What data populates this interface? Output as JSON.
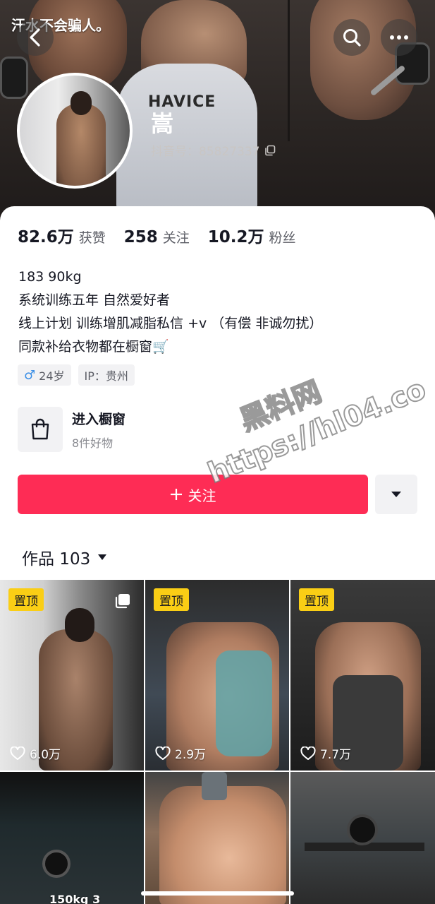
{
  "header": {
    "watermark": "汗水不会骗人。",
    "shirt_text": "HAVICE",
    "display_name": "嵩",
    "douyin_id": "抖音号：85827337"
  },
  "stats": [
    {
      "value": "82.6万",
      "label": "获赞"
    },
    {
      "value": "258",
      "label": "关注"
    },
    {
      "value": "10.2万",
      "label": "粉丝"
    }
  ],
  "bio": {
    "line1": "183 90kg",
    "line2": "系统训练五年 自然爱好者",
    "line3": "线上计划 训练增肌减脂私信 +v （有偿 非诚勿扰）",
    "line4": "同款补给衣物都在橱窗🛒"
  },
  "tags": {
    "age": "24岁",
    "ip": "IP：贵州"
  },
  "shop": {
    "title": "进入橱窗",
    "subtitle": "8件好物"
  },
  "follow": {
    "label": "关注"
  },
  "works": {
    "label": "作品 103"
  },
  "site_watermark": {
    "line1": "黑料网",
    "line2": "https://hl04.co"
  },
  "videos": [
    {
      "pinned": "置顶",
      "likes": "6.0万"
    },
    {
      "pinned": "置顶",
      "likes": "2.9万"
    },
    {
      "pinned": "置顶",
      "likes": "7.7万"
    },
    {
      "caption": "150kg 3"
    },
    {},
    {}
  ],
  "colors": {
    "follow_button": "#fe2c55",
    "pinned_badge": "#face15",
    "male_icon": "#3a8ee6"
  }
}
